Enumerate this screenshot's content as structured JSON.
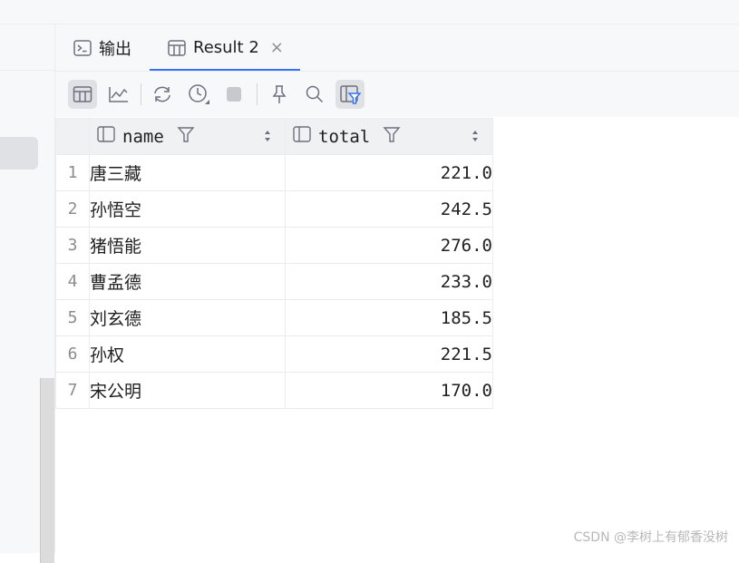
{
  "tabs": [
    {
      "label": "输出",
      "icon": "terminal-icon"
    },
    {
      "label": "Result 2",
      "icon": "table-icon",
      "close": "×"
    }
  ],
  "toolbar": {
    "items": [
      "table-view-icon",
      "chart-view-icon",
      "refresh-icon",
      "history-icon",
      "stop-icon",
      "pin-icon",
      "search-icon",
      "filter-icon"
    ]
  },
  "table": {
    "columns": [
      "name",
      "total"
    ],
    "rows": [
      {
        "idx": "1",
        "name": "唐三藏",
        "total": "221.0"
      },
      {
        "idx": "2",
        "name": "孙悟空",
        "total": "242.5"
      },
      {
        "idx": "3",
        "name": "猪悟能",
        "total": "276.0"
      },
      {
        "idx": "4",
        "name": "曹孟德",
        "total": "233.0"
      },
      {
        "idx": "5",
        "name": "刘玄德",
        "total": "185.5"
      },
      {
        "idx": "6",
        "name": "孙权",
        "total": "221.5"
      },
      {
        "idx": "7",
        "name": "宋公明",
        "total": "170.0"
      }
    ]
  },
  "watermark": "CSDN @李树上有郁香没树",
  "colors": {
    "accent": "#3574f0",
    "filter_active": "#3574f0"
  }
}
